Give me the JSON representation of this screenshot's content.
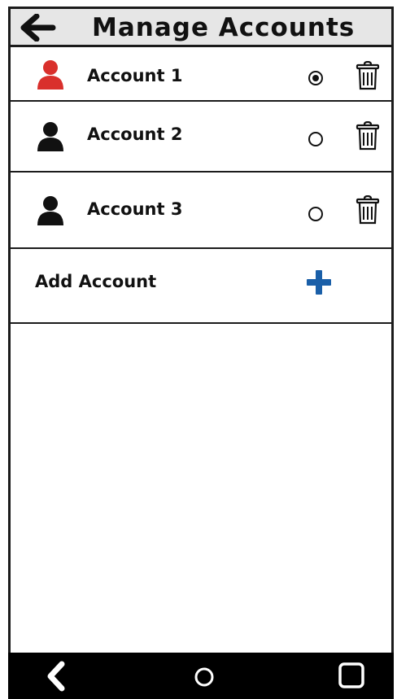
{
  "header": {
    "title": "Manage Accounts",
    "back_icon": "arrow-left-icon"
  },
  "accounts": [
    {
      "name": "Account 1",
      "selected": true,
      "avatar_color": "#d9302c",
      "avatar_icon": "user-icon",
      "delete_icon": "trash-icon"
    },
    {
      "name": "Account 2",
      "selected": false,
      "avatar_color": "#111111",
      "avatar_icon": "user-icon",
      "delete_icon": "trash-icon"
    },
    {
      "name": "Account 3",
      "selected": false,
      "avatar_color": "#111111",
      "avatar_icon": "user-icon",
      "delete_icon": "trash-icon"
    }
  ],
  "add_account": {
    "label": "Add Account",
    "icon": "plus-icon",
    "icon_color": "#1a5fa8"
  },
  "navbar": {
    "back_icon": "chevron-left-icon",
    "home_icon": "circle-home-icon",
    "recents_icon": "square-recents-icon"
  },
  "colors": {
    "header_bg": "#e6e6e6",
    "navbar_bg": "#000000",
    "active_avatar": "#d9302c",
    "accent_plus": "#1a5fa8"
  }
}
